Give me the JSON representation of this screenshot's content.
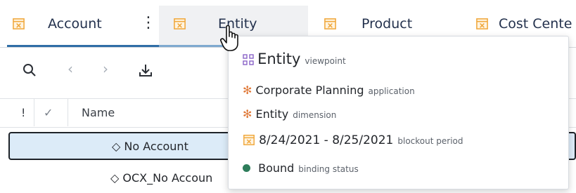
{
  "tabs": [
    {
      "label": "Account"
    },
    {
      "label": "Entity"
    },
    {
      "label": "Product"
    },
    {
      "label": "Cost Cente"
    }
  ],
  "toolbar": {
    "search_icon": "search-icon",
    "prev_icon": "chevron-left-icon",
    "next_icon": "chevron-right-icon",
    "download_icon": "download-icon"
  },
  "grid": {
    "columns": [
      "!",
      "✓",
      "Name"
    ],
    "rows": [
      {
        "name": "No Account",
        "selected": true
      },
      {
        "name": "OCX_No Accoun",
        "selected": false
      }
    ]
  },
  "popup": {
    "title": "Entity",
    "title_type": "viewpoint",
    "application": "Corporate Planning",
    "application_type": "application",
    "dimension": "Entity",
    "dimension_type": "dimension",
    "blockout": "8/24/2021 - 8/25/2021",
    "blockout_type": "blockout period",
    "binding": "Bound",
    "binding_type": "binding status",
    "colors": {
      "bound_dot": "#2e7d5b",
      "app_icon": "#e07a3a",
      "viewpoint_icon": "#8a63c8",
      "calendar_icon": "#f0a73a"
    }
  }
}
